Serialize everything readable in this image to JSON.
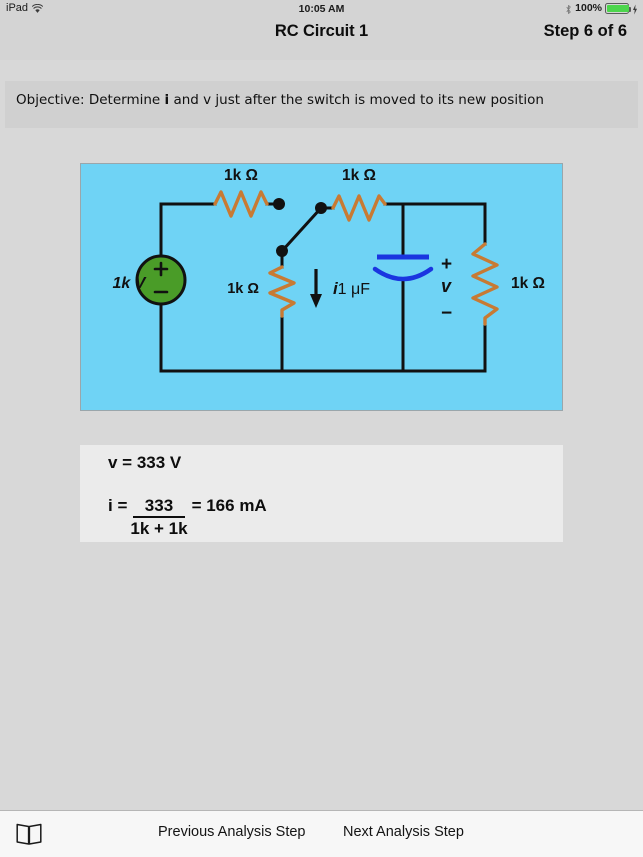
{
  "status_bar": {
    "device": "iPad",
    "wifi_icon": "wifi-icon",
    "time": "10:05 AM",
    "bluetooth_icon": "bluetooth-icon",
    "battery_percent": "100%",
    "battery_level": 100,
    "charging_icon": "lightning-bolt-icon"
  },
  "header": {
    "title": "RC Circuit 1",
    "step_label": "Step  6 of  6",
    "current_step": 6,
    "total_steps": 6
  },
  "objective": {
    "prefix": "Objective: Determine ",
    "emphasis1": "i",
    "middle": " and v just after the switch is moved to its new position",
    "full_text": "Objective: Determine i and v just after the switch is moved to its new position"
  },
  "circuit": {
    "background_color": "#6fd3f5",
    "wire_color": "#111111",
    "resistor_color": "#c87a33",
    "source_color": "#4a9c28",
    "capacitor_color": "#1a35e0",
    "source_label": "1k V",
    "source_plus": "+",
    "source_minus": "−",
    "r_top_left_label": "1k Ω",
    "r_top_right_label": "1k Ω",
    "r_middle_label": "1k Ω",
    "r_right_label": "1k Ω",
    "capacitor_label": "1 μF",
    "current_label": "i",
    "voltage_label": "v",
    "voltage_plus": "+",
    "voltage_minus": "−"
  },
  "answer": {
    "v_line": "v = 333 V",
    "i_lead": "i =",
    "i_numerator": "333",
    "i_denominator": "1k + 1k",
    "i_result": "= 166 mA"
  },
  "toolbar": {
    "book_icon": "book-icon",
    "previous_label": "Previous Analysis Step",
    "next_label": "Next Analysis Step"
  }
}
